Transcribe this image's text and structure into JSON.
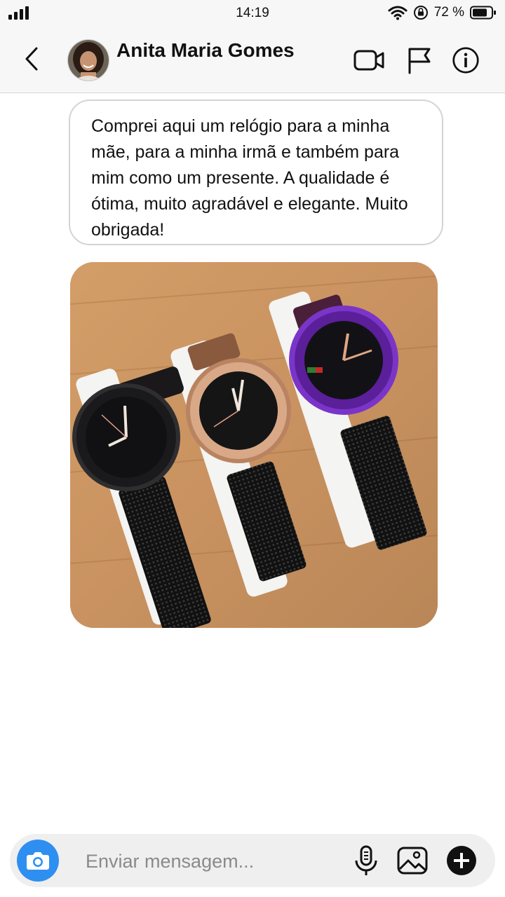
{
  "status": {
    "time": "14:19",
    "battery": "72 %"
  },
  "header": {
    "contact_name": "Anita Maria Gomes"
  },
  "message": {
    "text": "Comprei aqui um relógio para a minha mãe, para a minha irmã e também para mim como um presente. A qualidade é ótima, muito agradável e elegante. Muito obrigada!"
  },
  "composer": {
    "placeholder": "Enviar mensagem..."
  },
  "icons": {
    "back": "chevron-left-icon",
    "video": "video-camera-icon",
    "report": "flag-icon",
    "info": "info-icon",
    "camera": "camera-icon",
    "mic": "microphone-icon",
    "gallery": "image-icon",
    "add": "plus-icon"
  },
  "colors": {
    "accent": "#2f8ff0",
    "header_bg": "#f7f7f7",
    "composer_bg": "#efefef"
  }
}
